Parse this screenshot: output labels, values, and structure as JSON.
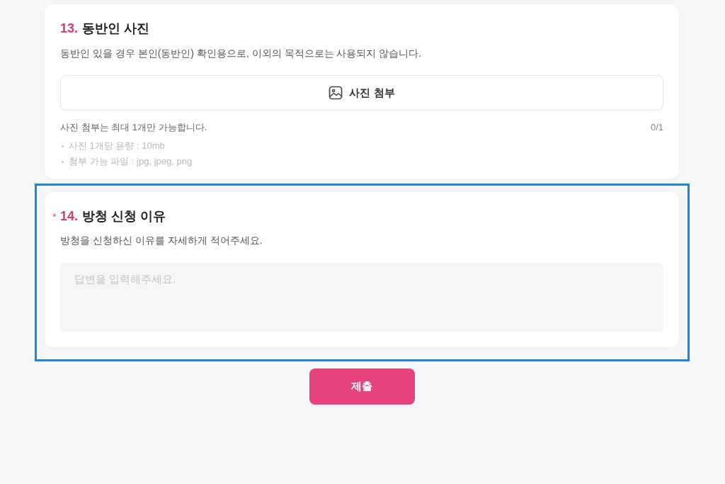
{
  "required_mark": "*",
  "questions": [
    {
      "kind": "attachment",
      "number": "13.",
      "title": "동반인 사진",
      "required": false,
      "highlighted": false,
      "description": "동반인 있을 경우 본인(동반인) 확인용으로, 이외의 목적으로는 사용되지 않습니다.",
      "attach_button": {
        "label": "사진 첨부"
      },
      "note": "사진 첨부는 최대 1개만 가능합니다.",
      "count": "0/1",
      "rules": [
        "사진 1개당 용량 : 10mb",
        "첨부 가능 파일 : jpg, jpeg, png"
      ]
    },
    {
      "kind": "text",
      "number": "14.",
      "title": "방청 신청 이유",
      "required": true,
      "highlighted": true,
      "description": "방청을 신청하신 이유를 자세하게 적어주세요.",
      "answer": {
        "placeholder": "답변을 입력해주세요."
      }
    }
  ],
  "submit_button": {
    "label": "제출"
  }
}
